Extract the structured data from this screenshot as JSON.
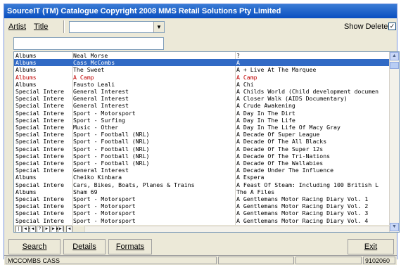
{
  "window": {
    "title": "SourceIT (TM) Catalogue Copyright 2008 MMS Retail Solutions Pty Limited"
  },
  "toolbar": {
    "artist_label": "Artist",
    "title_label": "Title",
    "combo_value": "",
    "show_deleted_label": "Show Deleted",
    "show_deleted_checked": "✓"
  },
  "search": {
    "value": ""
  },
  "grid": {
    "rows": [
      {
        "c1": "Albums",
        "c2": "Neal Morse",
        "c3": "?",
        "state": "normal"
      },
      {
        "c1": "Albums",
        "c2": "Cass McCombs",
        "c3": "A",
        "state": "selected"
      },
      {
        "c1": "Albums",
        "c2": "The Sweet",
        "c3": "A + Live At The Marquee",
        "state": "normal"
      },
      {
        "c1": "Albums",
        "c2": "A Camp",
        "c3": "A Camp",
        "state": "red"
      },
      {
        "c1": "Albums",
        "c2": "Fausto Leali",
        "c3": "A Chi",
        "state": "normal"
      },
      {
        "c1": "Special Intere",
        "c2": "General Interest",
        "c3": "A Childs World (Child development documen",
        "state": "normal"
      },
      {
        "c1": "Special Intere",
        "c2": "General Interest",
        "c3": "A Closer Walk (AIDS Documentary)",
        "state": "normal"
      },
      {
        "c1": "Special Intere",
        "c2": "General Interest",
        "c3": "A Crude Awakening",
        "state": "normal"
      },
      {
        "c1": "Special Intere",
        "c2": "Sport - Motorsport",
        "c3": "A Day In The Dirt",
        "state": "normal"
      },
      {
        "c1": "Special Intere",
        "c2": "Sport - Surfing",
        "c3": "A Day In The Life",
        "state": "normal"
      },
      {
        "c1": "Special Intere",
        "c2": "Music - Other",
        "c3": "A Day In The Life Of Macy Gray",
        "state": "normal"
      },
      {
        "c1": "Special Intere",
        "c2": "Sport - Football (NRL)",
        "c3": "A Decade Of Super League",
        "state": "normal"
      },
      {
        "c1": "Special Intere",
        "c2": "Sport - Football (NRL)",
        "c3": "A Decade Of The All Blacks",
        "state": "normal"
      },
      {
        "c1": "Special Intere",
        "c2": "Sport - Football (NRL)",
        "c3": "A Decade Of The Super 12s",
        "state": "normal"
      },
      {
        "c1": "Special Intere",
        "c2": "Sport - Football (NRL)",
        "c3": "A Decade Of The Tri-Nations",
        "state": "normal"
      },
      {
        "c1": "Special Intere",
        "c2": "Sport - Football (NRL)",
        "c3": "A Decade Of The Wallabies",
        "state": "normal"
      },
      {
        "c1": "Special Intere",
        "c2": "General Interest",
        "c3": "A Decade Under The Influence",
        "state": "normal"
      },
      {
        "c1": "Albums",
        "c2": "Cheiko Kinbara",
        "c3": "A Espera",
        "state": "normal"
      },
      {
        "c1": "Special Intere",
        "c2": "Cars, Bikes, Boats, Planes & Trains",
        "c3": "A Feast Of Steam: Including 100 British L",
        "state": "normal"
      },
      {
        "c1": "Albums",
        "c2": "Sham 69",
        "c3": "The A Files",
        "state": "normal"
      },
      {
        "c1": "Special Intere",
        "c2": "Sport - Motorsport",
        "c3": "A Gentlemans Motor Racing Diary Vol. 1",
        "state": "normal"
      },
      {
        "c1": "Special Intere",
        "c2": "Sport - Motorsport",
        "c3": "A Gentlemans Motor Racing Diary Vol. 2",
        "state": "normal"
      },
      {
        "c1": "Special Intere",
        "c2": "Sport - Motorsport",
        "c3": "A Gentlemans Motor Racing Diary Vol. 3",
        "state": "normal"
      },
      {
        "c1": "Special Intere",
        "c2": "Sport - Motorsport",
        "c3": "A Gentlemans Motor Racing Diary Vol. 4",
        "state": "normal"
      }
    ]
  },
  "buttons": {
    "search": "Search",
    "details": "Details",
    "formats": "Formats",
    "exit": "Exit"
  },
  "status": {
    "left": "MCCOMBS CASS",
    "right": "9102060"
  }
}
